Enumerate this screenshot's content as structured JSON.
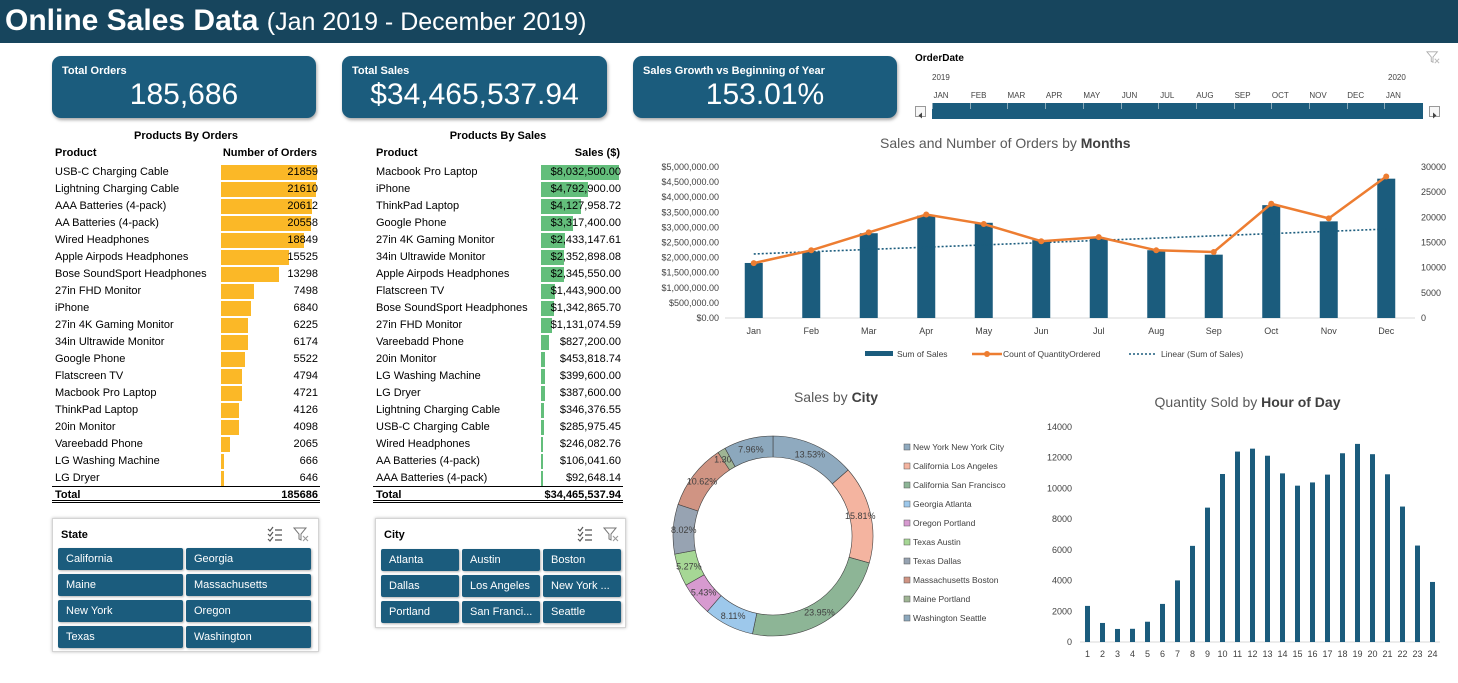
{
  "header": {
    "title": "Online Sales Data",
    "subtitle": "(Jan 2019 - December 2019)"
  },
  "kpis": {
    "total_orders": {
      "label": "Total Orders",
      "value": "185,686"
    },
    "total_sales": {
      "label": "Total Sales",
      "value": "$34,465,537.94"
    },
    "sales_growth": {
      "label": "Sales Growth vs Beginning of Year",
      "value": "153.01%"
    }
  },
  "products_by_orders": {
    "title": "Products By Orders",
    "col_product": "Product",
    "col_value": "Number of Orders",
    "bar_color": "#fbb827",
    "rows": [
      {
        "product": "USB-C Charging Cable",
        "value": "21859",
        "n": 21859
      },
      {
        "product": "Lightning Charging Cable",
        "value": "21610",
        "n": 21610
      },
      {
        "product": "AAA Batteries (4-pack)",
        "value": "20612",
        "n": 20612
      },
      {
        "product": "AA Batteries (4-pack)",
        "value": "20558",
        "n": 20558
      },
      {
        "product": "Wired Headphones",
        "value": "18849",
        "n": 18849
      },
      {
        "product": "Apple Airpods Headphones",
        "value": "15525",
        "n": 15525
      },
      {
        "product": "Bose SoundSport Headphones",
        "value": "13298",
        "n": 13298
      },
      {
        "product": "27in FHD Monitor",
        "value": "7498",
        "n": 7498
      },
      {
        "product": "iPhone",
        "value": "6840",
        "n": 6840
      },
      {
        "product": "27in 4K Gaming Monitor",
        "value": "6225",
        "n": 6225
      },
      {
        "product": "34in Ultrawide Monitor",
        "value": "6174",
        "n": 6174
      },
      {
        "product": "Google Phone",
        "value": "5522",
        "n": 5522
      },
      {
        "product": "Flatscreen TV",
        "value": "4794",
        "n": 4794
      },
      {
        "product": "Macbook Pro Laptop",
        "value": "4721",
        "n": 4721
      },
      {
        "product": "ThinkPad Laptop",
        "value": "4126",
        "n": 4126
      },
      {
        "product": "20in Monitor",
        "value": "4098",
        "n": 4098
      },
      {
        "product": "Vareebadd Phone",
        "value": "2065",
        "n": 2065
      },
      {
        "product": "LG Washing Machine",
        "value": "666",
        "n": 666
      },
      {
        "product": "LG Dryer",
        "value": "646",
        "n": 646
      }
    ],
    "total_label": "Total",
    "total_value": "185686"
  },
  "products_by_sales": {
    "title": "Products By Sales",
    "col_product": "Product",
    "col_value": "Sales ($)",
    "bar_color": "#63be7b",
    "rows": [
      {
        "product": "Macbook Pro Laptop",
        "value": "$8,032,500.00",
        "n": 8032500.0
      },
      {
        "product": "iPhone",
        "value": "$4,792,900.00",
        "n": 4792900.0
      },
      {
        "product": "ThinkPad Laptop",
        "value": "$4,127,958.72",
        "n": 4127958.72
      },
      {
        "product": "Google Phone",
        "value": "$3,317,400.00",
        "n": 3317400.0
      },
      {
        "product": "27in 4K Gaming Monitor",
        "value": "$2,433,147.61",
        "n": 2433147.61
      },
      {
        "product": "34in Ultrawide Monitor",
        "value": "$2,352,898.08",
        "n": 2352898.08
      },
      {
        "product": "Apple Airpods Headphones",
        "value": "$2,345,550.00",
        "n": 2345550.0
      },
      {
        "product": "Flatscreen TV",
        "value": "$1,443,900.00",
        "n": 1443900.0
      },
      {
        "product": "Bose SoundSport Headphones",
        "value": "$1,342,865.70",
        "n": 1342865.7
      },
      {
        "product": "27in FHD Monitor",
        "value": "$1,131,074.59",
        "n": 1131074.59
      },
      {
        "product": "Vareebadd Phone",
        "value": "$827,200.00",
        "n": 827200.0
      },
      {
        "product": "20in Monitor",
        "value": "$453,818.74",
        "n": 453818.74
      },
      {
        "product": "LG Washing Machine",
        "value": "$399,600.00",
        "n": 399600.0
      },
      {
        "product": "LG Dryer",
        "value": "$387,600.00",
        "n": 387600.0
      },
      {
        "product": "Lightning Charging Cable",
        "value": "$346,376.55",
        "n": 346376.55
      },
      {
        "product": "USB-C Charging Cable",
        "value": "$285,975.45",
        "n": 285975.45
      },
      {
        "product": "Wired Headphones",
        "value": "$246,082.76",
        "n": 246082.76
      },
      {
        "product": "AA Batteries (4-pack)",
        "value": "$106,041.60",
        "n": 106041.6
      },
      {
        "product": "AAA Batteries (4-pack)",
        "value": "$92,648.14",
        "n": 92648.14
      }
    ],
    "total_label": "Total",
    "total_value": "$34,465,537.94"
  },
  "state_slicer": {
    "header": "State",
    "icons": [
      "multi-select-icon",
      "clear-filter-icon"
    ],
    "items": [
      "California",
      "Georgia",
      "Maine",
      "Massachusetts",
      "New York",
      "Oregon",
      "Texas",
      "Washington"
    ]
  },
  "city_slicer": {
    "header": "City",
    "icons": [
      "multi-select-icon",
      "clear-filter-icon"
    ],
    "items": [
      "Atlanta",
      "Austin",
      "Boston",
      "Dallas",
      "Los Angeles",
      "New York ...",
      "Portland",
      "San Franci...",
      "Seattle"
    ]
  },
  "timeline": {
    "header": "OrderDate",
    "year_start": "2019",
    "year_end": "2020",
    "months": [
      "JAN",
      "FEB",
      "MAR",
      "APR",
      "MAY",
      "JUN",
      "JUL",
      "AUG",
      "SEP",
      "OCT",
      "NOV",
      "DEC",
      "JAN"
    ],
    "clear_icon": "clear-filter-icon"
  },
  "chart_data": [
    {
      "type": "bar",
      "title": "Sales and Number of Orders by Months",
      "title_prefix": "Sales and Number of Orders by",
      "title_bold": "Months",
      "categories": [
        "Jan",
        "Feb",
        "Mar",
        "Apr",
        "May",
        "Jun",
        "Jul",
        "Aug",
        "Sep",
        "Oct",
        "Nov",
        "Dec"
      ],
      "series": [
        {
          "name": "Sum of Sales",
          "type": "bar",
          "axis": "left",
          "color": "#1b5c7d",
          "values": [
            1822256.73,
            2202022.42,
            2807100.38,
            3390670.24,
            3152606.75,
            2577802.26,
            2647775.76,
            2244467.88,
            2097560.13,
            3736726.88,
            3199603.2,
            4613443.34
          ]
        },
        {
          "name": "Count of QuantityOrdered",
          "type": "line",
          "axis": "right",
          "color": "#ed7d31",
          "values": [
            10903,
            13449,
            17005,
            20558,
            18667,
            15253,
            16072,
            13448,
            13109,
            22703,
            19798,
            28114
          ]
        },
        {
          "name": "Linear (Sum of Sales)",
          "type": "trendline",
          "axis": "left",
          "color": "#1b5c7d",
          "values": [
            2120000,
            2195000,
            2270000,
            2345000,
            2420000,
            2495000,
            2570000,
            2645000,
            2720000,
            2795000,
            2870000,
            2945000
          ]
        }
      ],
      "y_left": {
        "min": 0,
        "max": 5000000,
        "step": 500000,
        "ticks": [
          "$0.00",
          "$500,000.00",
          "$1,000,000.00",
          "$1,500,000.00",
          "$2,000,000.00",
          "$2,500,000.00",
          "$3,000,000.00",
          "$3,500,000.00",
          "$4,000,000.00",
          "$4,500,000.00",
          "$5,000,000.00"
        ]
      },
      "y_right": {
        "min": 0,
        "max": 30000,
        "step": 5000,
        "ticks": [
          "0",
          "5000",
          "10000",
          "15000",
          "20000",
          "25000",
          "30000"
        ]
      },
      "grid": false,
      "legend": "bottom"
    },
    {
      "type": "pie",
      "title": "Sales by City",
      "title_prefix": "Sales by",
      "title_bold": "City",
      "series": [
        {
          "name": "New York New York City",
          "value": 13.53,
          "label": "13.53%",
          "color": "#8faabf"
        },
        {
          "name": "California Los Angeles",
          "value": 15.81,
          "label": "15.81%",
          "color": "#f4b4a0"
        },
        {
          "name": "California San Francisco",
          "value": 23.95,
          "label": "23.95%",
          "color": "#8db596"
        },
        {
          "name": "Georgia Atlanta",
          "value": 8.11,
          "label": "8.11%",
          "color": "#9dc8eb"
        },
        {
          "name": "Oregon Portland",
          "value": 5.43,
          "label": "5.43%",
          "color": "#d79ad0"
        },
        {
          "name": "Texas Austin",
          "value": 5.27,
          "label": "5.27%",
          "color": "#a6d795"
        },
        {
          "name": "Texas Dallas",
          "value": 8.02,
          "label": "8.02%",
          "color": "#97a3b2"
        },
        {
          "name": "Massachusetts Boston",
          "value": 10.62,
          "label": "10.62%",
          "color": "#d09483"
        },
        {
          "name": "Maine Portland",
          "value": 1.3,
          "label": "1.30%",
          "color": "#9fb594"
        },
        {
          "name": "Washington Seattle",
          "value": 7.96,
          "label": "7.96%",
          "color": "#8ca8bd"
        }
      ],
      "legend": "right",
      "donut": true
    },
    {
      "type": "bar",
      "title": "Quantity Sold by Hour of Day",
      "title_prefix": "Quantity Sold by",
      "title_bold": "Hour of Day",
      "categories": [
        "1",
        "2",
        "3",
        "4",
        "5",
        "6",
        "7",
        "8",
        "9",
        "10",
        "11",
        "12",
        "13",
        "14",
        "15",
        "16",
        "17",
        "18",
        "19",
        "20",
        "21",
        "22",
        "23",
        "24"
      ],
      "series": [
        {
          "name": "",
          "color": "#1b5c7d",
          "values": [
            2350,
            1240,
            850,
            860,
            1320,
            2480,
            4010,
            6260,
            8750,
            10940,
            12400,
            12590,
            12130,
            10980,
            10180,
            10390,
            10900,
            12290,
            12900,
            12230,
            10920,
            8820,
            6280,
            3910
          ]
        }
      ],
      "ylim": [
        0,
        14000
      ],
      "y_ticks": [
        "0",
        "2000",
        "4000",
        "6000",
        "8000",
        "10000",
        "12000",
        "14000"
      ],
      "grid": false
    }
  ]
}
